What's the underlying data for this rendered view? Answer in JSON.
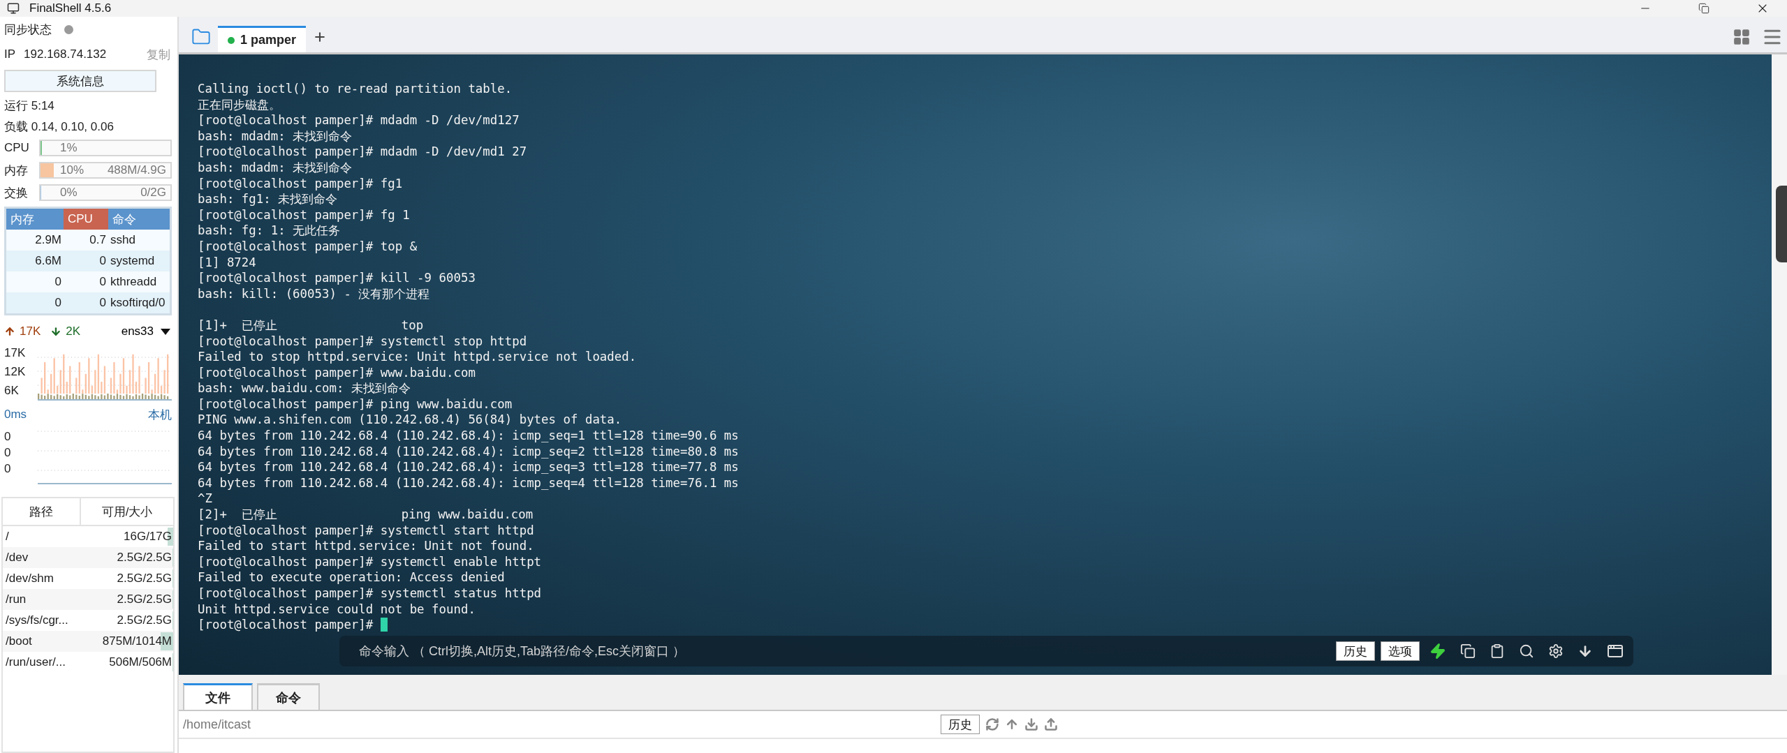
{
  "window": {
    "title": "FinalShell 4.5.6"
  },
  "sidebar": {
    "sync": {
      "label": "同步状态",
      "synced": false
    },
    "ip": {
      "label": "IP",
      "value": "192.168.74.132",
      "copy": "复制"
    },
    "system_info_button": "系统信息",
    "uptime": "运行 5:14",
    "load": "负载 0.14, 0.10, 0.06",
    "meters": [
      {
        "label": "CPU",
        "reading": "1%",
        "level": 0.01,
        "color": "#7cc48a"
      },
      {
        "label": "内存",
        "reading": "10%",
        "detail": "488M/4.9G",
        "level": 0.1,
        "color": "#f7c59f"
      },
      {
        "label": "交换",
        "reading": "0%",
        "detail": "0/2G",
        "level": 0,
        "color": "#9fc5e8"
      }
    ],
    "processes": {
      "columns": [
        {
          "label": "内存",
          "color": "#5b93cc"
        },
        {
          "label": "CPU",
          "color": "#c96450"
        },
        {
          "label": "命令",
          "color": "#5b93cc"
        }
      ],
      "rows": [
        [
          "2.9M",
          "0.7",
          "sshd"
        ],
        [
          "6.6M",
          "0",
          "systemd"
        ],
        [
          "0",
          "0",
          "kthreadd"
        ],
        [
          "0",
          "0",
          "ksoftirqd/0"
        ]
      ]
    },
    "network": {
      "upload": "17K",
      "download": "2K",
      "interface": "ens33",
      "y_labels": [
        "17K",
        "12K",
        "6K"
      ]
    },
    "latency": {
      "reading": "0ms",
      "host": "本机",
      "y_labels": [
        "0",
        "0",
        "0"
      ]
    },
    "disks": {
      "columns": [
        "路径",
        "可用/大小"
      ],
      "rows": [
        {
          "path": "/",
          "size": "16G/17G",
          "level": 0.06
        },
        {
          "path": "/dev",
          "size": "2.5G/2.5G",
          "level": 0
        },
        {
          "path": "/dev/shm",
          "size": "2.5G/2.5G",
          "level": 0
        },
        {
          "path": "/run",
          "size": "2.5G/2.5G",
          "level": 0
        },
        {
          "path": "/sys/fs/cgr...",
          "size": "2.5G/2.5G",
          "level": 0
        },
        {
          "path": "/boot",
          "size": "875M/1014M",
          "level": 0.14
        },
        {
          "path": "/run/user/...",
          "size": "506M/506M",
          "level": 0
        }
      ]
    }
  },
  "tabs": [
    {
      "label": "1 pamper",
      "selected": true,
      "connected": true
    }
  ],
  "terminal": {
    "groups": [
      [
        "Calling ioctl() to re-read partition table.",
        "正在同步磁盘。",
        "[root@localhost pamper]# mdadm -D /dev/md127",
        "bash: mdadm: 未找到命令",
        "[root@localhost pamper]# mdadm -D /dev/md1 27",
        "bash: mdadm: 未找到命令",
        "[root@localhost pamper]# fg1",
        "bash: fg1: 未找到命令",
        "[root@localhost pamper]# fg 1",
        "bash: fg: 1: 无此任务",
        "[root@localhost pamper]# top &",
        "[1] 8724",
        "[root@localhost pamper]# kill -9 60053",
        "bash: kill: (60053) - 没有那个进程"
      ],
      [
        "[1]+  已停止                 top",
        "[root@localhost pamper]# systemctl stop httpd",
        "Failed to stop httpd.service: Unit httpd.service not loaded.",
        "[root@localhost pamper]# www.baidu.com",
        "bash: www.baidu.com: 未找到命令",
        "[root@localhost pamper]# ping www.baidu.com",
        "PING www.a.shifen.com (110.242.68.4) 56(84) bytes of data.",
        "64 bytes from 110.242.68.4 (110.242.68.4): icmp_seq=1 ttl=128 time=90.6 ms",
        "64 bytes from 110.242.68.4 (110.242.68.4): icmp_seq=2 ttl=128 time=80.8 ms",
        "64 bytes from 110.242.68.4 (110.242.68.4): icmp_seq=3 ttl=128 time=77.8 ms",
        "64 bytes from 110.242.68.4 (110.242.68.4): icmp_seq=4 ttl=128 time=76.1 ms",
        "^Z",
        "[2]+  已停止                 ping www.baidu.com",
        "[root@localhost pamper]# systemctl start httpd",
        "Failed to start httpd.service: Unit not found.",
        "[root@localhost pamper]# systemctl enable httpt",
        "Failed to execute operation: Access denied",
        "[root@localhost pamper]# systemctl status httpd",
        "Unit httpd.service could not be found.",
        "[root@localhost pamper]# "
      ]
    ],
    "cursor": true
  },
  "command_bar": {
    "placeholder": "命令输入 （ Ctrl切换,Alt历史,Tab路径/命令,Esc关闭窗口 ）",
    "buttons": [
      "历史",
      "选项"
    ]
  },
  "bottom_panel": {
    "tabs": [
      {
        "label": "文件",
        "selected": true
      },
      {
        "label": "命令",
        "selected": false
      }
    ],
    "path": "/home/itcast",
    "history_button": "历史"
  }
}
